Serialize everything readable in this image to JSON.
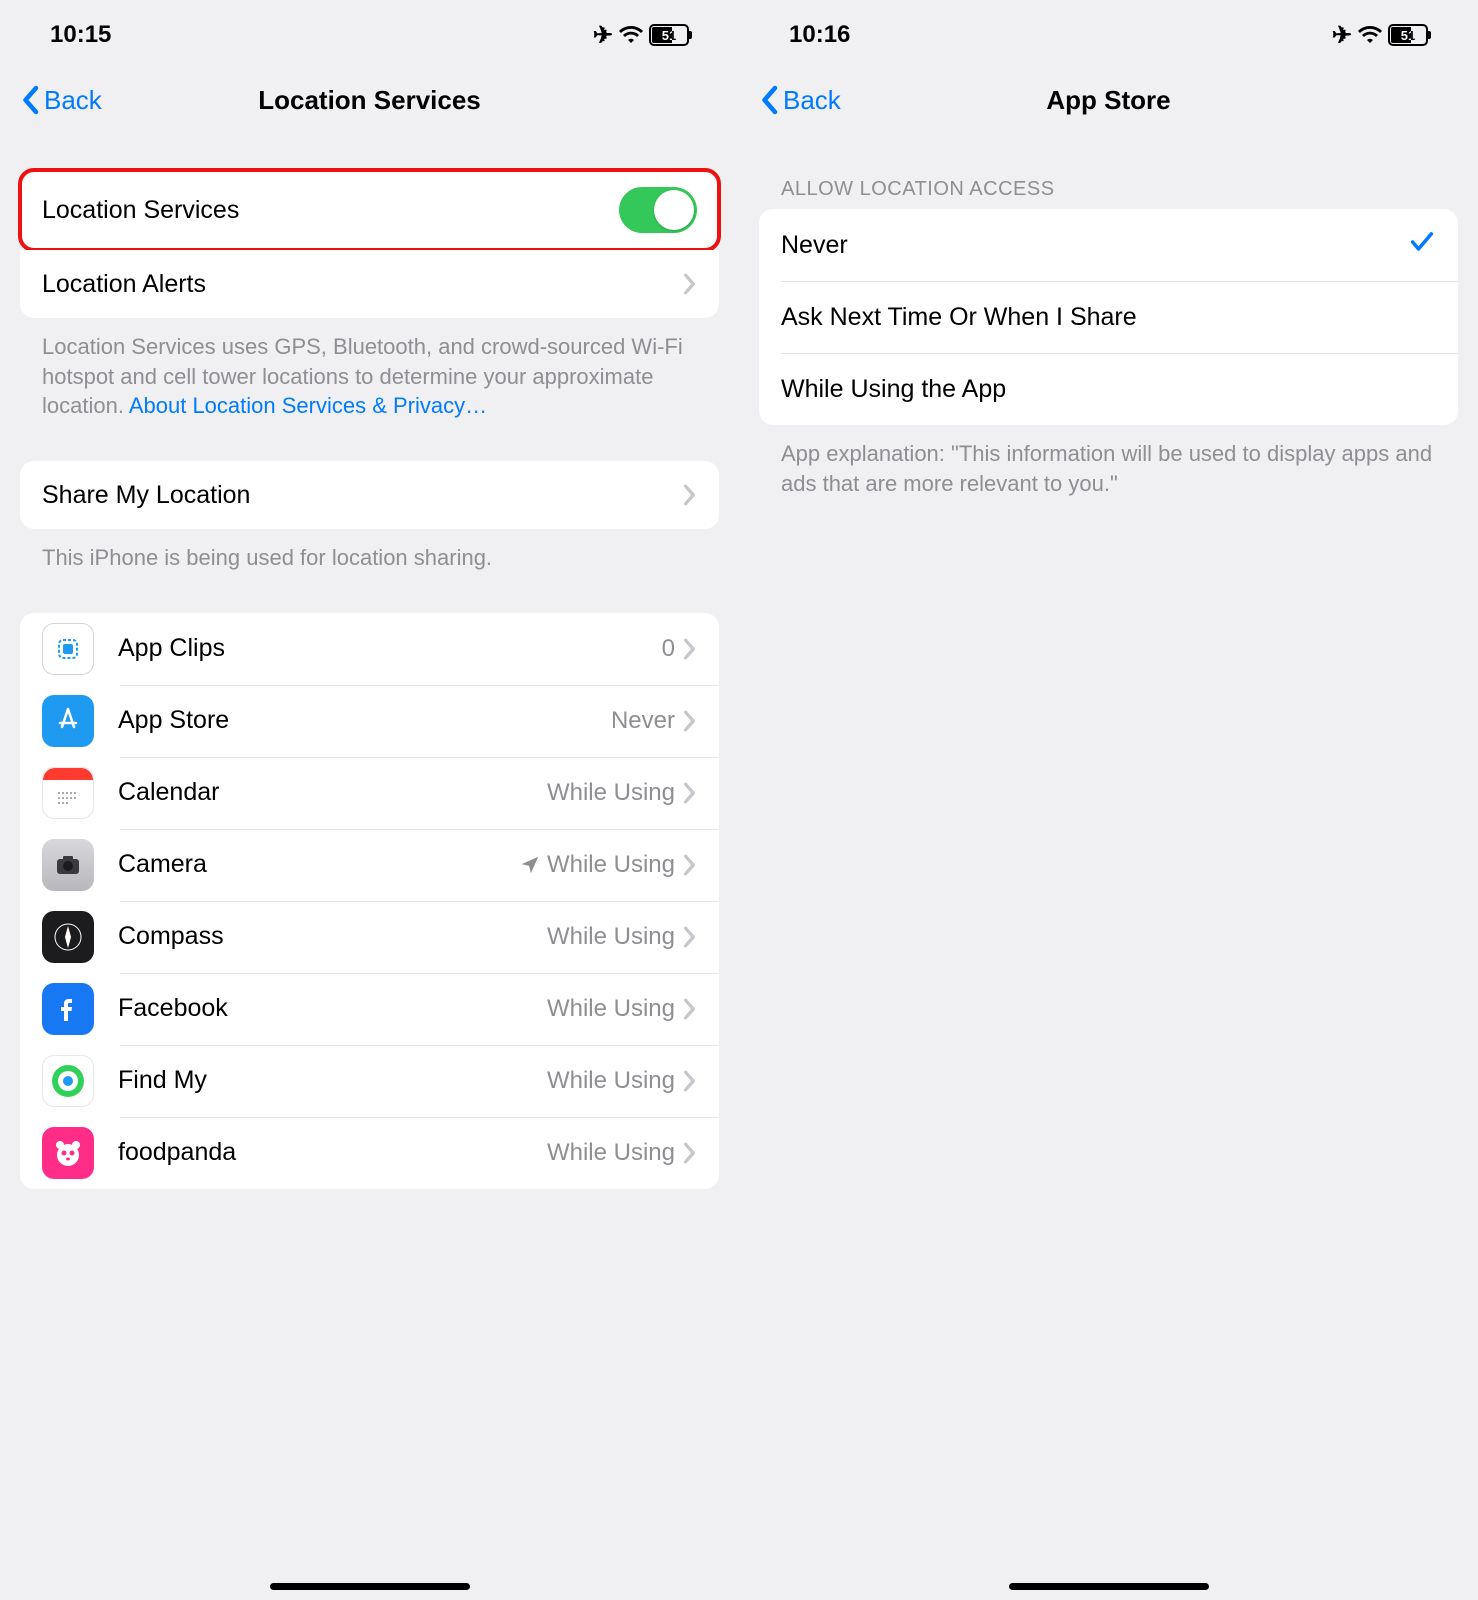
{
  "left": {
    "status": {
      "time": "10:15",
      "battery": "51"
    },
    "nav": {
      "back": "Back",
      "title": "Location Services"
    },
    "main_toggle": {
      "label": "Location Services",
      "on": true
    },
    "alerts": {
      "label": "Location Alerts"
    },
    "desc": "Location Services uses GPS, Bluetooth, and crowd-sourced Wi-Fi hotspot and cell tower locations to determine your approximate location. ",
    "desc_link": "About Location Services & Privacy…",
    "share": {
      "label": "Share My Location"
    },
    "share_desc": "This iPhone is being used for location sharing.",
    "apps": [
      {
        "name": "App Clips",
        "value": "0",
        "icon": "ic-appclips",
        "arrow": false
      },
      {
        "name": "App Store",
        "value": "Never",
        "icon": "ic-appstore",
        "arrow": false
      },
      {
        "name": "Calendar",
        "value": "While Using",
        "icon": "ic-calendar",
        "arrow": false
      },
      {
        "name": "Camera",
        "value": "While Using",
        "icon": "ic-camera",
        "arrow": true
      },
      {
        "name": "Compass",
        "value": "While Using",
        "icon": "ic-compass",
        "arrow": false
      },
      {
        "name": "Facebook",
        "value": "While Using",
        "icon": "ic-facebook",
        "arrow": false
      },
      {
        "name": "Find My",
        "value": "While Using",
        "icon": "ic-findmy",
        "arrow": false
      },
      {
        "name": "foodpanda",
        "value": "While Using",
        "icon": "ic-foodpanda",
        "arrow": false
      }
    ]
  },
  "right": {
    "status": {
      "time": "10:16",
      "battery": "51"
    },
    "nav": {
      "back": "Back",
      "title": "App Store"
    },
    "section_header": "ALLOW LOCATION ACCESS",
    "options": [
      {
        "label": "Never",
        "selected": true
      },
      {
        "label": "Ask Next Time Or When I Share",
        "selected": false
      },
      {
        "label": "While Using the App",
        "selected": false
      }
    ],
    "explanation": "App explanation: \"This information will be used to display apps and ads that are more relevant to you.\""
  }
}
